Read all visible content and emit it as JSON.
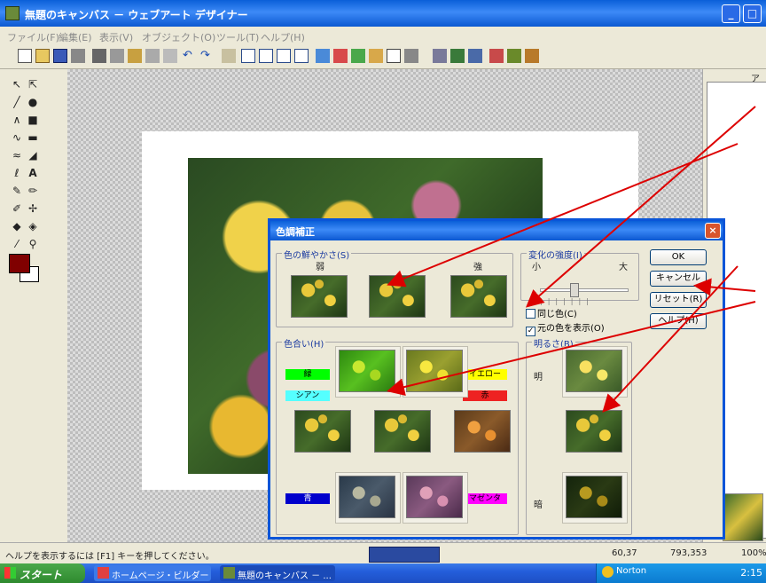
{
  "window": {
    "title": "無題のキャンバス － ウェブアート デザイナー",
    "minimize": "_",
    "maximize": "□",
    "close": "×"
  },
  "menubar": [
    "ファイル(F)",
    "編集(E)",
    "表示(V)",
    "オブジェクト(O)",
    "ツール(T)",
    "ヘルプ(H)"
  ],
  "palette": {
    "foreground": "#800000",
    "background": "#ffffff"
  },
  "right_panel": {
    "header": "アニ"
  },
  "dialog": {
    "title": "色調補正",
    "close": "×",
    "group_brightness": {
      "label": "色の鮮やかさ(S)",
      "low": "弱",
      "high": "強"
    },
    "group_step": {
      "label": "変化の強度(I)",
      "small": "小",
      "large": "大",
      "ticks": "|||||||"
    },
    "checkbox_1": {
      "label": "同じ色(C)",
      "checked": false
    },
    "checkbox_2": {
      "label": "元の色を表示(O)",
      "checked": true
    },
    "group_hue": {
      "label": "色合い(H)",
      "green": "緑",
      "yellow": "イエロー",
      "cyan": "シアン",
      "red": "赤",
      "blue": "青",
      "magenta": "マゼンタ"
    },
    "group_lightness": {
      "label": "明るさ(B)",
      "light": "明",
      "dark": "暗"
    },
    "buttons": {
      "ok": "OK",
      "cancel": "キャンセル",
      "reset": "リセット(R)",
      "help": "ヘルプ(H)"
    },
    "colors": {
      "green": "#00ff00",
      "cyan": "#55ffff",
      "yellow": "#ffff00",
      "red": "#ee2222",
      "blue": "#0000cc",
      "magenta": "#ff00ff"
    }
  },
  "statusbar": {
    "help": "ヘルプを表示するには [F1] キーを押してください。",
    "coord": "60,37",
    "size": "793,353",
    "zoom": "100%"
  },
  "taskbar": {
    "start": "スタート",
    "items": [
      "ホームページ・ビルダー",
      "無題のキャンバス － ..."
    ],
    "norton": "Norton",
    "clock": "2:15"
  },
  "annotation_color": "#dd0000"
}
